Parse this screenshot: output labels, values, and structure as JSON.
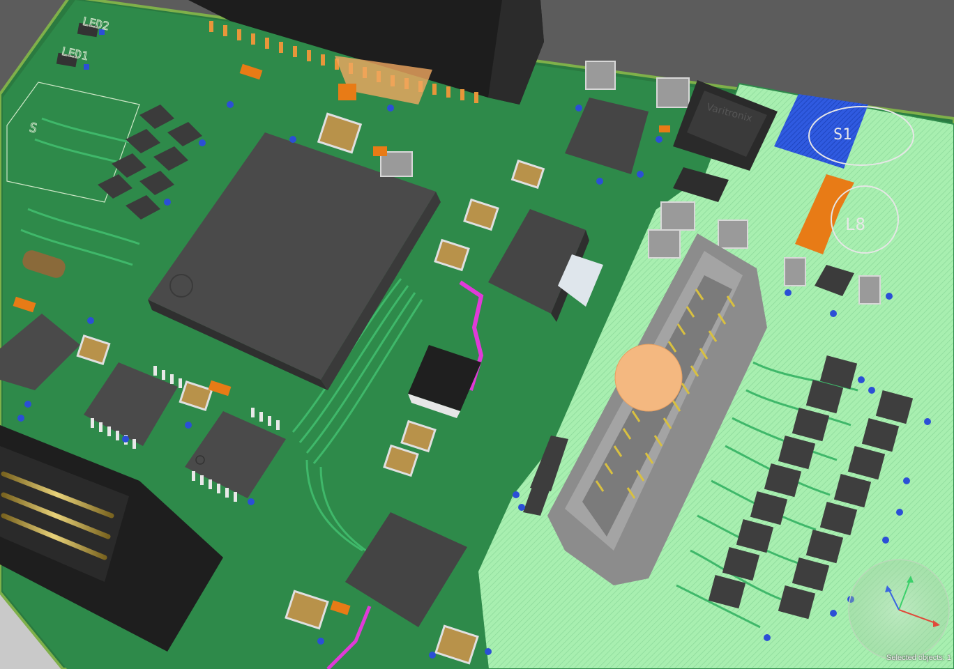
{
  "app": {
    "view": "pcb-3d-view",
    "selection_status": "Selected objects: 1"
  },
  "board": {
    "silkscreen_labels": {
      "led2": "LED2",
      "led1": "LED1",
      "s1": "S1",
      "l8": "L8",
      "s_left": "S",
      "inductor_marking": "Varitronix"
    }
  },
  "colors": {
    "board_green": "#2e8a4a",
    "board_dark": "#1f6b36",
    "copper_pour": "#a8efb0",
    "trace": "#3fb86a",
    "ic_body": "#4a4a4a",
    "connector_grey": "#9b9b9b",
    "gold_pin": "#d8c040",
    "pad_blue": "#2b4fd6",
    "pad_orange": "#e87b16",
    "trace_magenta": "#e03ad8",
    "selection_marker": "#f4b880",
    "background": "#5a5a5a"
  },
  "icons": {
    "navigation_cube": "axis-gizmo-icon"
  }
}
